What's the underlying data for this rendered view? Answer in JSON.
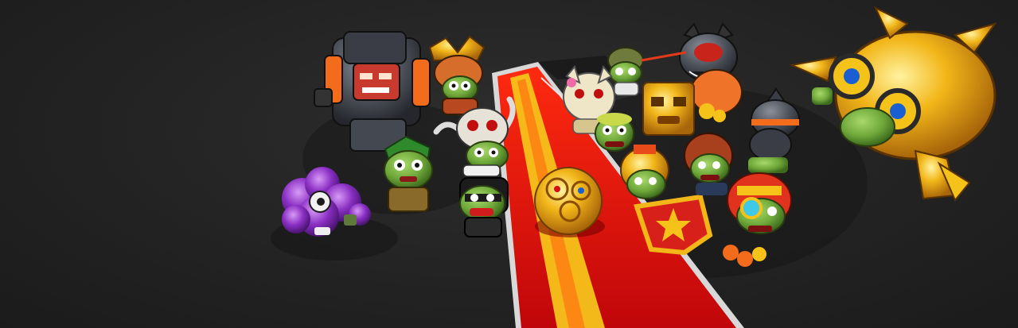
{
  "scene": {
    "kind": "game-banner",
    "colors": {
      "background": "#252525",
      "carpet_red": "#e0100c",
      "carpet_stripe": "#f5c21a",
      "trim_white": "#e8e8e8",
      "gold": "#f2b619",
      "zombie_green": "#6fa83a"
    },
    "characters": [
      {
        "id": "purple-blob",
        "icon": "purple-blob-zombie-icon"
      },
      {
        "id": "armored-knight",
        "icon": "heavy-armor-zombie-icon"
      },
      {
        "id": "samurai",
        "icon": "samurai-helmet-zombie-icon"
      },
      {
        "id": "green-hood",
        "icon": "green-hood-zombie-icon"
      },
      {
        "id": "horned-skull",
        "icon": "horned-skull-zombie-icon"
      },
      {
        "id": "ninja",
        "icon": "ninja-zombie-icon"
      },
      {
        "id": "golden-ball",
        "icon": "golden-sphere-icon"
      },
      {
        "id": "helmet-scout",
        "icon": "helmet-zombie-icon"
      },
      {
        "id": "goat-mask",
        "icon": "goat-mask-zombie-icon"
      },
      {
        "id": "cat-robot",
        "icon": "cat-robot-zombie-icon"
      },
      {
        "id": "tiki-box",
        "icon": "tiki-box-zombie-icon"
      },
      {
        "id": "bald-zombie",
        "icon": "bald-zombie-icon"
      },
      {
        "id": "spartan-shield",
        "icon": "spartan-shield-zombie-icon"
      },
      {
        "id": "football-zombie",
        "icon": "football-helmet-zombie-icon"
      },
      {
        "id": "drill-hat",
        "icon": "drill-hat-zombie-icon"
      },
      {
        "id": "pharaoh-goggles",
        "icon": "pharaoh-goggles-zombie-icon"
      },
      {
        "id": "golden-mech",
        "icon": "golden-mech-zombie-icon"
      }
    ]
  }
}
